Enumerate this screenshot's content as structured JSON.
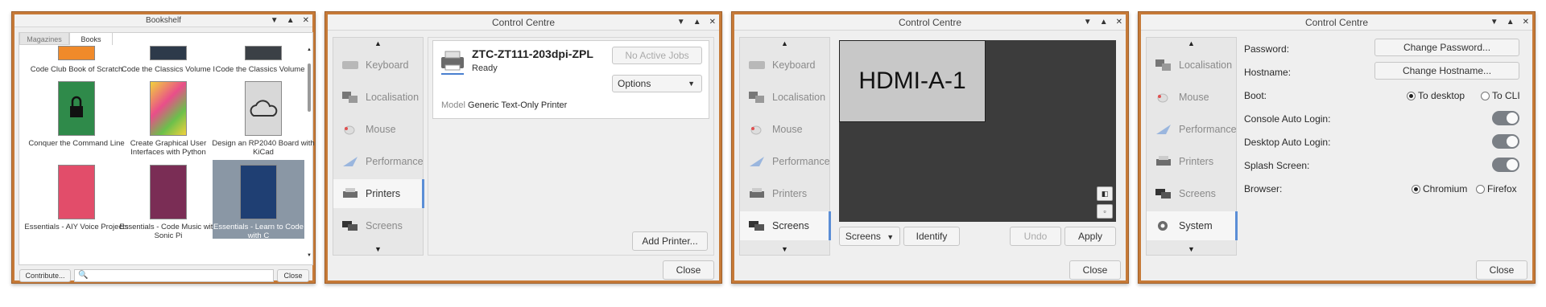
{
  "bookshelf": {
    "title": "Bookshelf",
    "tabs": [
      "Magazines",
      "Books"
    ],
    "books_top": [
      "Code Club Book of Scratch",
      "Code the Classics Volume I",
      "Code the Classics Volume II"
    ],
    "books_row2": [
      "Conquer the Command Line",
      "Create Graphical User Interfaces with Python",
      "Design an RP2040 Board with KiCad"
    ],
    "books_row3": [
      "Essentials - AIY Voice Projects",
      "Essentials - Code Music with Sonic Pi",
      "Essentials - Learn to Code with C"
    ],
    "contribute_label": "Contribute...",
    "search_placeholder": "",
    "close_label": "Close",
    "search_icon": "search-icon"
  },
  "printers_window": {
    "title": "Control Centre",
    "sidebar": [
      "Keyboard",
      "Localisation",
      "Mouse",
      "Performance",
      "Printers",
      "Screens"
    ],
    "selected": "Printers",
    "printer_name": "ZTC-ZT111-203dpi-ZPL",
    "printer_status": "Ready",
    "no_jobs_label": "No Active Jobs",
    "options_label": "Options",
    "model_label": "Model",
    "model_value": "Generic Text-Only Printer",
    "add_printer_label": "Add Printer...",
    "close_label": "Close"
  },
  "screens_window": {
    "title": "Control Centre",
    "sidebar": [
      "Keyboard",
      "Localisation",
      "Mouse",
      "Performance",
      "Printers",
      "Screens"
    ],
    "selected": "Screens",
    "display_name": "HDMI-A-1",
    "screens_menu_label": "Screens",
    "identify_label": "Identify",
    "undo_label": "Undo",
    "apply_label": "Apply",
    "close_label": "Close"
  },
  "system_window": {
    "title": "Control Centre",
    "sidebar": [
      "Localisation",
      "Mouse",
      "Performance",
      "Printers",
      "Screens",
      "System"
    ],
    "selected": "System",
    "password_label": "Password:",
    "change_password_label": "Change Password...",
    "hostname_label": "Hostname:",
    "change_hostname_label": "Change Hostname...",
    "boot_label": "Boot:",
    "boot_options": [
      "To desktop",
      "To CLI"
    ],
    "boot_selected": "To desktop",
    "console_autologin_label": "Console Auto Login:",
    "desktop_autologin_label": "Desktop Auto Login:",
    "splash_label": "Splash Screen:",
    "browser_label": "Browser:",
    "browser_options": [
      "Chromium",
      "Firefox"
    ],
    "browser_selected": "Chromium",
    "close_label": "Close"
  },
  "titlebar_controls": [
    "minimize-icon",
    "maximize-icon",
    "close-icon"
  ]
}
